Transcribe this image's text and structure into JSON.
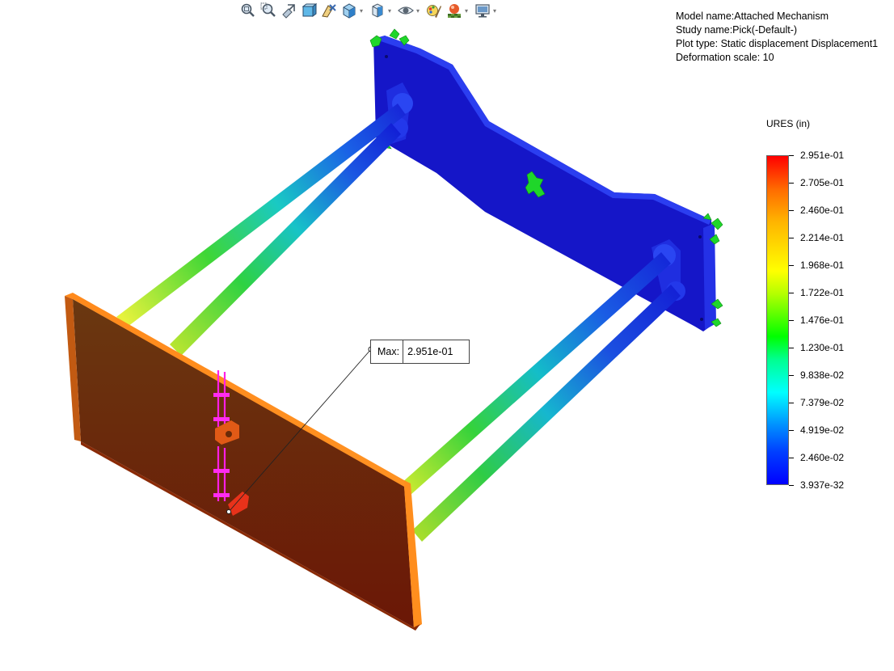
{
  "toolbar": {
    "items": [
      {
        "icon": "zoom-to-fit-icon",
        "dropdown": false
      },
      {
        "icon": "zoom-to-area-icon",
        "dropdown": false
      },
      {
        "icon": "previous-view-icon",
        "dropdown": false
      },
      {
        "icon": "section-view-icon",
        "dropdown": false
      },
      {
        "icon": "dynamic-annotation-icon",
        "dropdown": false
      },
      {
        "icon": "view-orientation-icon",
        "dropdown": true
      },
      {
        "icon": "display-style-icon",
        "dropdown": true
      },
      {
        "icon": "hide-show-items-icon",
        "dropdown": true
      },
      {
        "icon": "edit-appearance-icon",
        "dropdown": false
      },
      {
        "icon": "apply-scene-icon",
        "dropdown": true
      },
      {
        "icon": "view-settings-icon",
        "dropdown": true
      }
    ]
  },
  "study_info": {
    "model_name": "Model name:Attached Mechanism",
    "study_name": "Study name:Pick(-Default-)",
    "plot_type": "Plot type: Static displacement Displacement1",
    "deformation_scale": "Deformation scale: 10"
  },
  "legend": {
    "title": "URES (in)",
    "ticks": [
      "2.951e-01",
      "2.705e-01",
      "2.460e-01",
      "2.214e-01",
      "1.968e-01",
      "1.722e-01",
      "1.476e-01",
      "1.230e-01",
      "9.838e-02",
      "7.379e-02",
      "4.919e-02",
      "2.460e-02",
      "3.937e-32"
    ],
    "max_color": "#ff0000",
    "min_color": "#0000ff"
  },
  "probe": {
    "label": "Max:",
    "value": "2.951e-01"
  }
}
